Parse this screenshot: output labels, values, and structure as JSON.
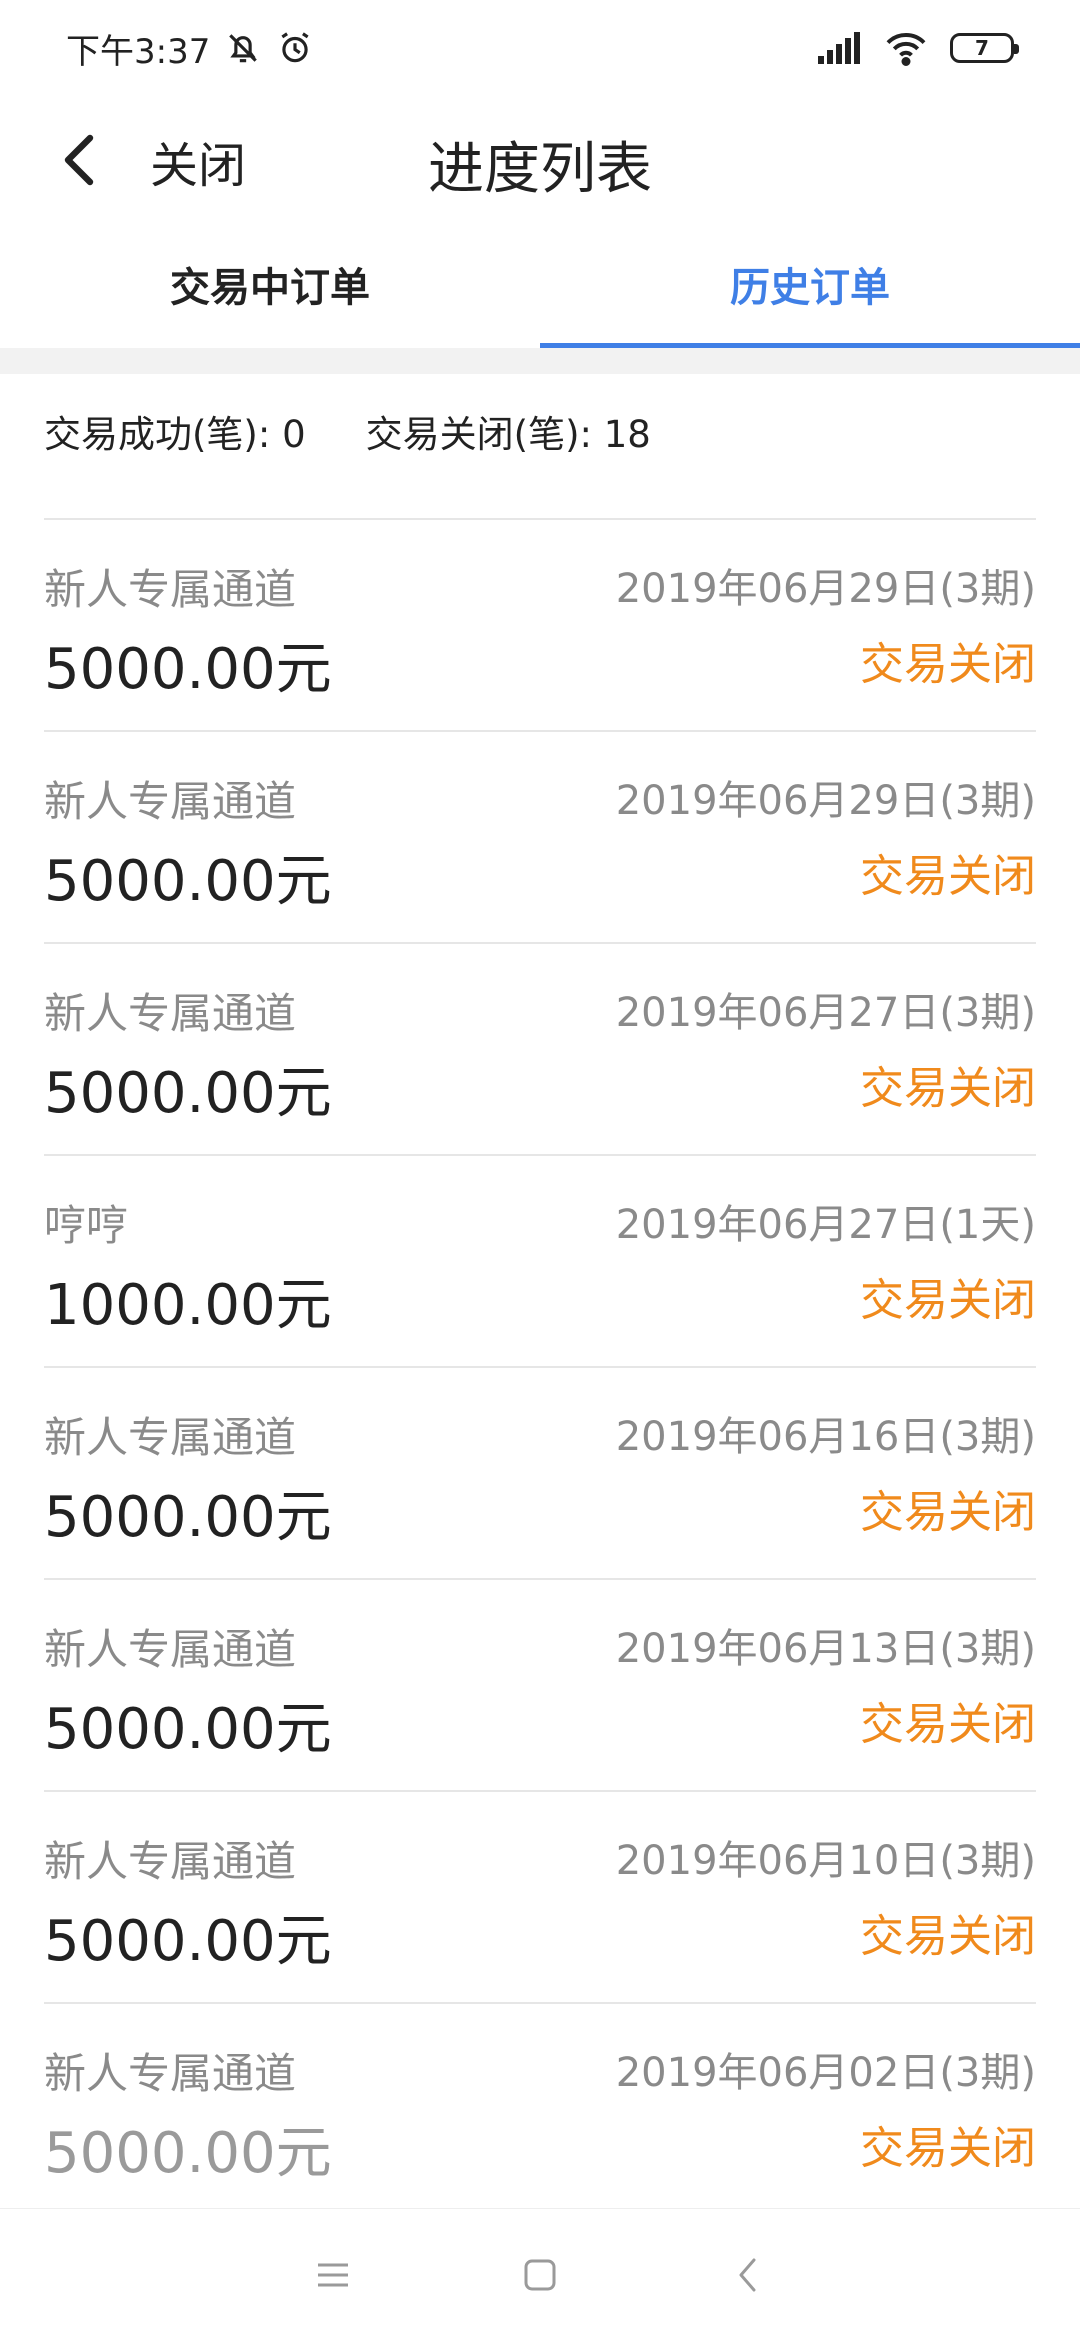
{
  "status_bar": {
    "time": "下午3:37",
    "battery": "7",
    "icons": [
      "mute-bell-icon",
      "alarm-icon",
      "signal-icon",
      "wifi-icon",
      "battery-icon"
    ]
  },
  "header": {
    "close_label": "关闭",
    "title": "进度列表"
  },
  "tabs": [
    {
      "label": "交易中订单",
      "active": false
    },
    {
      "label": "历史订单",
      "active": true
    }
  ],
  "summary": {
    "success_label": "交易成功(笔): 0",
    "closed_label": "交易关闭(笔): 18"
  },
  "orders": [
    {
      "name": "新人专属通道",
      "amount": "5000.00元",
      "date": "2019年06月29日(3期)",
      "status": "交易关闭"
    },
    {
      "name": "新人专属通道",
      "amount": "5000.00元",
      "date": "2019年06月29日(3期)",
      "status": "交易关闭"
    },
    {
      "name": "新人专属通道",
      "amount": "5000.00元",
      "date": "2019年06月27日(3期)",
      "status": "交易关闭"
    },
    {
      "name": "哼哼",
      "amount": "1000.00元",
      "date": "2019年06月27日(1天)",
      "status": "交易关闭"
    },
    {
      "name": "新人专属通道",
      "amount": "5000.00元",
      "date": "2019年06月16日(3期)",
      "status": "交易关闭"
    },
    {
      "name": "新人专属通道",
      "amount": "5000.00元",
      "date": "2019年06月13日(3期)",
      "status": "交易关闭"
    },
    {
      "name": "新人专属通道",
      "amount": "5000.00元",
      "date": "2019年06月10日(3期)",
      "status": "交易关闭"
    },
    {
      "name": "新人专属通道",
      "amount": "5000.00元",
      "date": "2019年06月02日(3期)",
      "status": "交易关闭"
    }
  ],
  "colors": {
    "accent": "#3f7fe6",
    "status_closed": "#f08a1c"
  }
}
